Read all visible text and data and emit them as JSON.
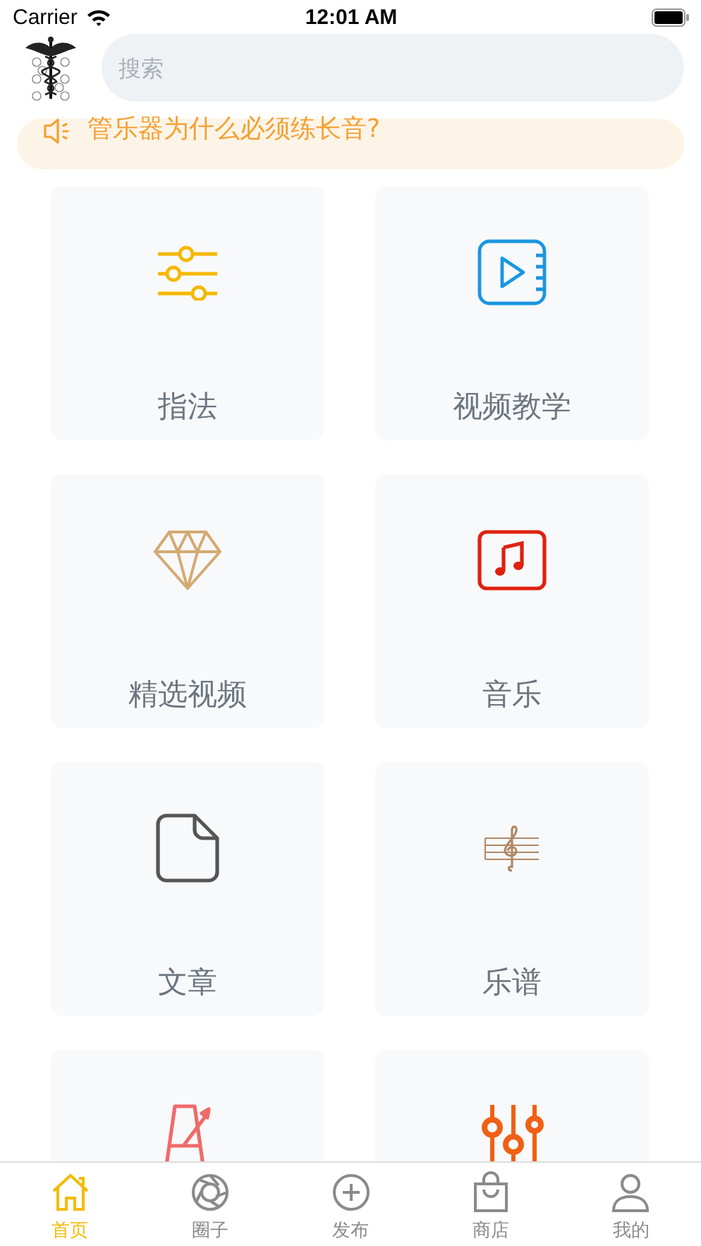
{
  "status_bar": {
    "carrier": "Carrier",
    "time": "12:01 AM"
  },
  "search": {
    "placeholder": "搜索"
  },
  "notice": {
    "text": "管乐器为什么必须练长音?"
  },
  "features": [
    {
      "kind": "sliders",
      "label": "指法"
    },
    {
      "kind": "video",
      "label": "视频教学"
    },
    {
      "kind": "diamond",
      "label": "精选视频"
    },
    {
      "kind": "music",
      "label": "音乐"
    },
    {
      "kind": "document",
      "label": "文章"
    },
    {
      "kind": "score",
      "label": "乐谱"
    },
    {
      "kind": "metronome"
    },
    {
      "kind": "equalizer"
    }
  ],
  "tab_bar": [
    {
      "kind": "home",
      "label": "首页",
      "selected": true
    },
    {
      "kind": "aperture",
      "label": "圈子",
      "selected": false
    },
    {
      "kind": "plus",
      "label": "发布",
      "selected": false
    },
    {
      "kind": "bag",
      "label": "商店",
      "selected": false
    },
    {
      "kind": "person",
      "label": "我的",
      "selected": false
    }
  ]
}
